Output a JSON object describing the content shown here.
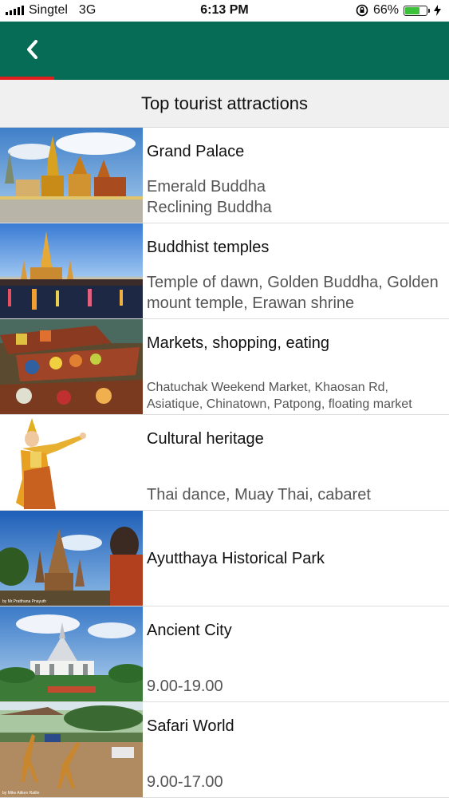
{
  "status_bar": {
    "carrier": "Singtel",
    "network": "3G",
    "time": "6:13 PM",
    "battery_percent": "66%",
    "battery_level": 0.66,
    "icons": [
      "signal-bars-icon",
      "rotation-lock-icon",
      "battery-icon",
      "charging-bolt-icon"
    ]
  },
  "header": {
    "back_icon": "chevron-left-icon",
    "progress": 0.12,
    "colors": {
      "bar": "#076c55",
      "progress": "#e01e1e"
    }
  },
  "page": {
    "title": "Top tourist attractions"
  },
  "attractions": [
    {
      "title": "Grand Palace",
      "subtitle": "Emerald Buddha\nReclining Buddha",
      "image": "grand-palace-photo"
    },
    {
      "title": "Buddhist temples",
      "subtitle": "Temple of dawn, Golden Buddha, Golden mount temple, Erawan shrine",
      "image": "temple-of-dawn-photo"
    },
    {
      "title": "Markets, shopping, eating",
      "subtitle": "Chatuchak Weekend Market, Khaosan Rd, Asiatique, Chinatown, Patpong, floating market",
      "image": "floating-market-photo"
    },
    {
      "title": "Cultural heritage",
      "subtitle": "Thai dance, Muay Thai, cabaret",
      "image": "thai-dancer-photo"
    },
    {
      "title": "Ayutthaya Historical Park",
      "subtitle": "",
      "image": "ayutthaya-ruins-photo",
      "photo_credit": "by Mr.Pratthana Pnayuth"
    },
    {
      "title": "Ancient City",
      "subtitle": "9.00-19.00",
      "image": "ancient-city-pavilion-photo"
    },
    {
      "title": "Safari World",
      "subtitle": "9.00-17.00",
      "image": "safari-giraffes-photo",
      "photo_credit": "by Mike Aitken Ratlin"
    }
  ]
}
